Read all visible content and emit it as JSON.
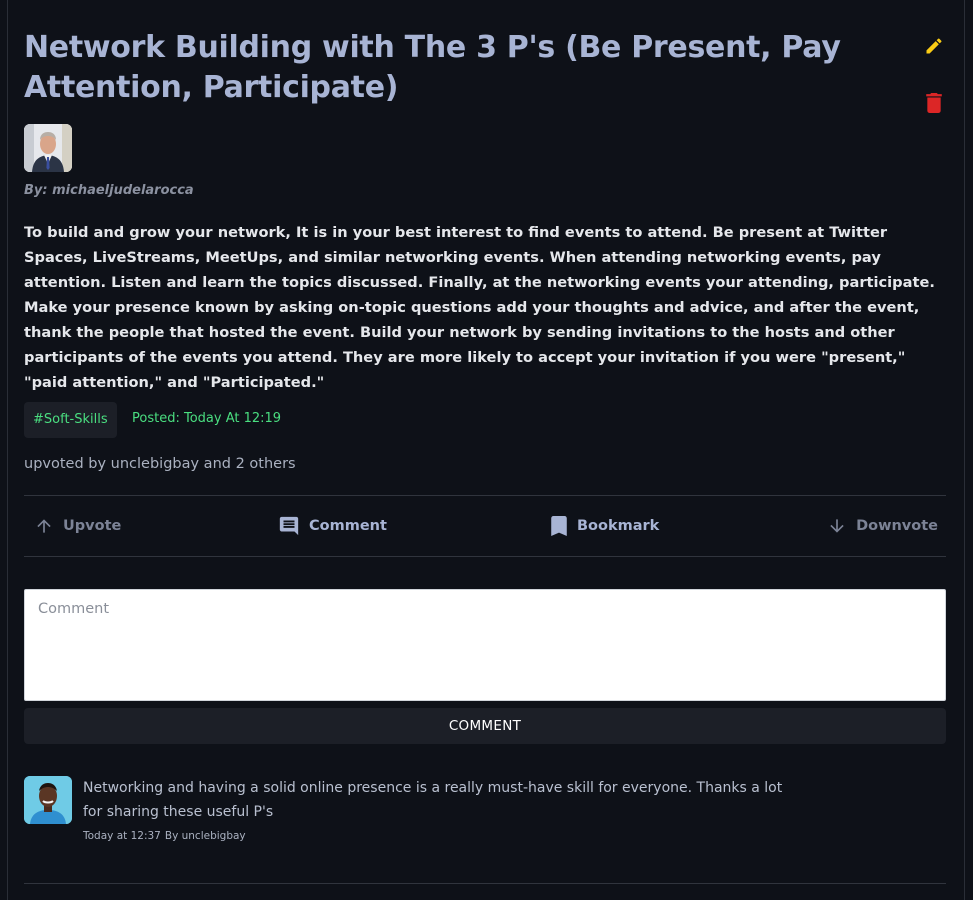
{
  "post": {
    "title": "Network Building with The 3 P's (Be Present, Pay Attention, Participate)",
    "byline": "By: michaeljudelarocca",
    "body": "To build and grow your network, It is in your best interest to find events to attend. Be present at Twitter Spaces, LiveStreams, MeetUps, and similar networking events. When attending networking events, pay attention. Listen and learn the topics discussed. Finally, at the networking events your attending, participate. Make your presence known by asking on-topic questions add your thoughts and advice, and after the event, thank the people that hosted the event. Build your network by sending invitations to the hosts and other participants of the events you attend. They are more likely to accept your invitation if you were \"present,\" \"paid attention,\" and \"Participated.\"",
    "tag": "#Soft-Skills",
    "posted": "Posted: Today At 12:19",
    "upvoted_by": "upvoted by unclebigbay and 2 others"
  },
  "actions": {
    "upvote": "Upvote",
    "comment": "Comment",
    "bookmark": "Bookmark",
    "downvote": "Downvote"
  },
  "comment_form": {
    "placeholder": "Comment",
    "submit_label": "COMMENT"
  },
  "comments": [
    {
      "text": "Networking and having a solid online presence is a really must-have skill for everyone. Thanks a lot for sharing these useful P's",
      "time": "Today at 12:37",
      "author": "By unclebigbay"
    }
  ],
  "icons": {
    "edit": "pencil-icon",
    "delete": "trash-icon",
    "upvote": "arrow-up-icon",
    "comment": "comment-icon",
    "bookmark": "bookmark-icon",
    "downvote": "arrow-down-icon"
  },
  "colors": {
    "background": "#0e1118",
    "title": "#a8b4d4",
    "tag_text": "#4ade80",
    "edit_icon": "#facc15",
    "delete_icon": "#dc2626"
  }
}
